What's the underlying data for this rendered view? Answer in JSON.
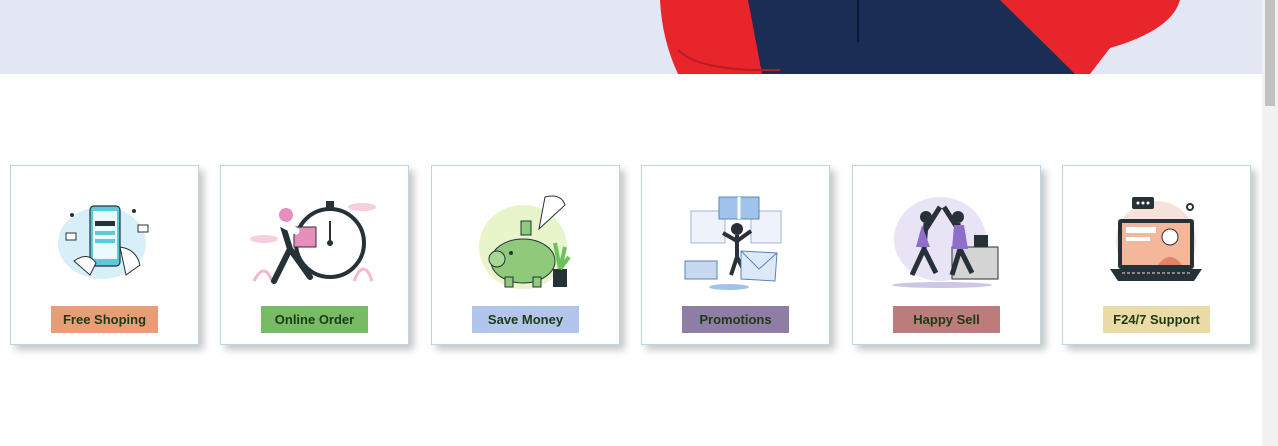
{
  "features": [
    {
      "label": "Free Shoping",
      "icon": "payment-phone-icon",
      "color": "#e99d77"
    },
    {
      "label": "Online Order",
      "icon": "delivery-stopwatch-icon",
      "color": "#78bb66"
    },
    {
      "label": "Save Money",
      "icon": "piggy-bank-icon",
      "color": "#b1c6ea"
    },
    {
      "label": "Promotions",
      "icon": "gift-celebration-icon",
      "color": "#8e7ea6"
    },
    {
      "label": "Happy Sell",
      "icon": "high-five-icon",
      "color": "#bd7b7b"
    },
    {
      "label": "F24/7 Support",
      "icon": "support-laptop-icon",
      "color": "#eadba7"
    }
  ],
  "colors": {
    "hero_bg": "#e3e7f3",
    "jacket_red": "#e8252b",
    "jacket_navy": "#1b2d55"
  }
}
